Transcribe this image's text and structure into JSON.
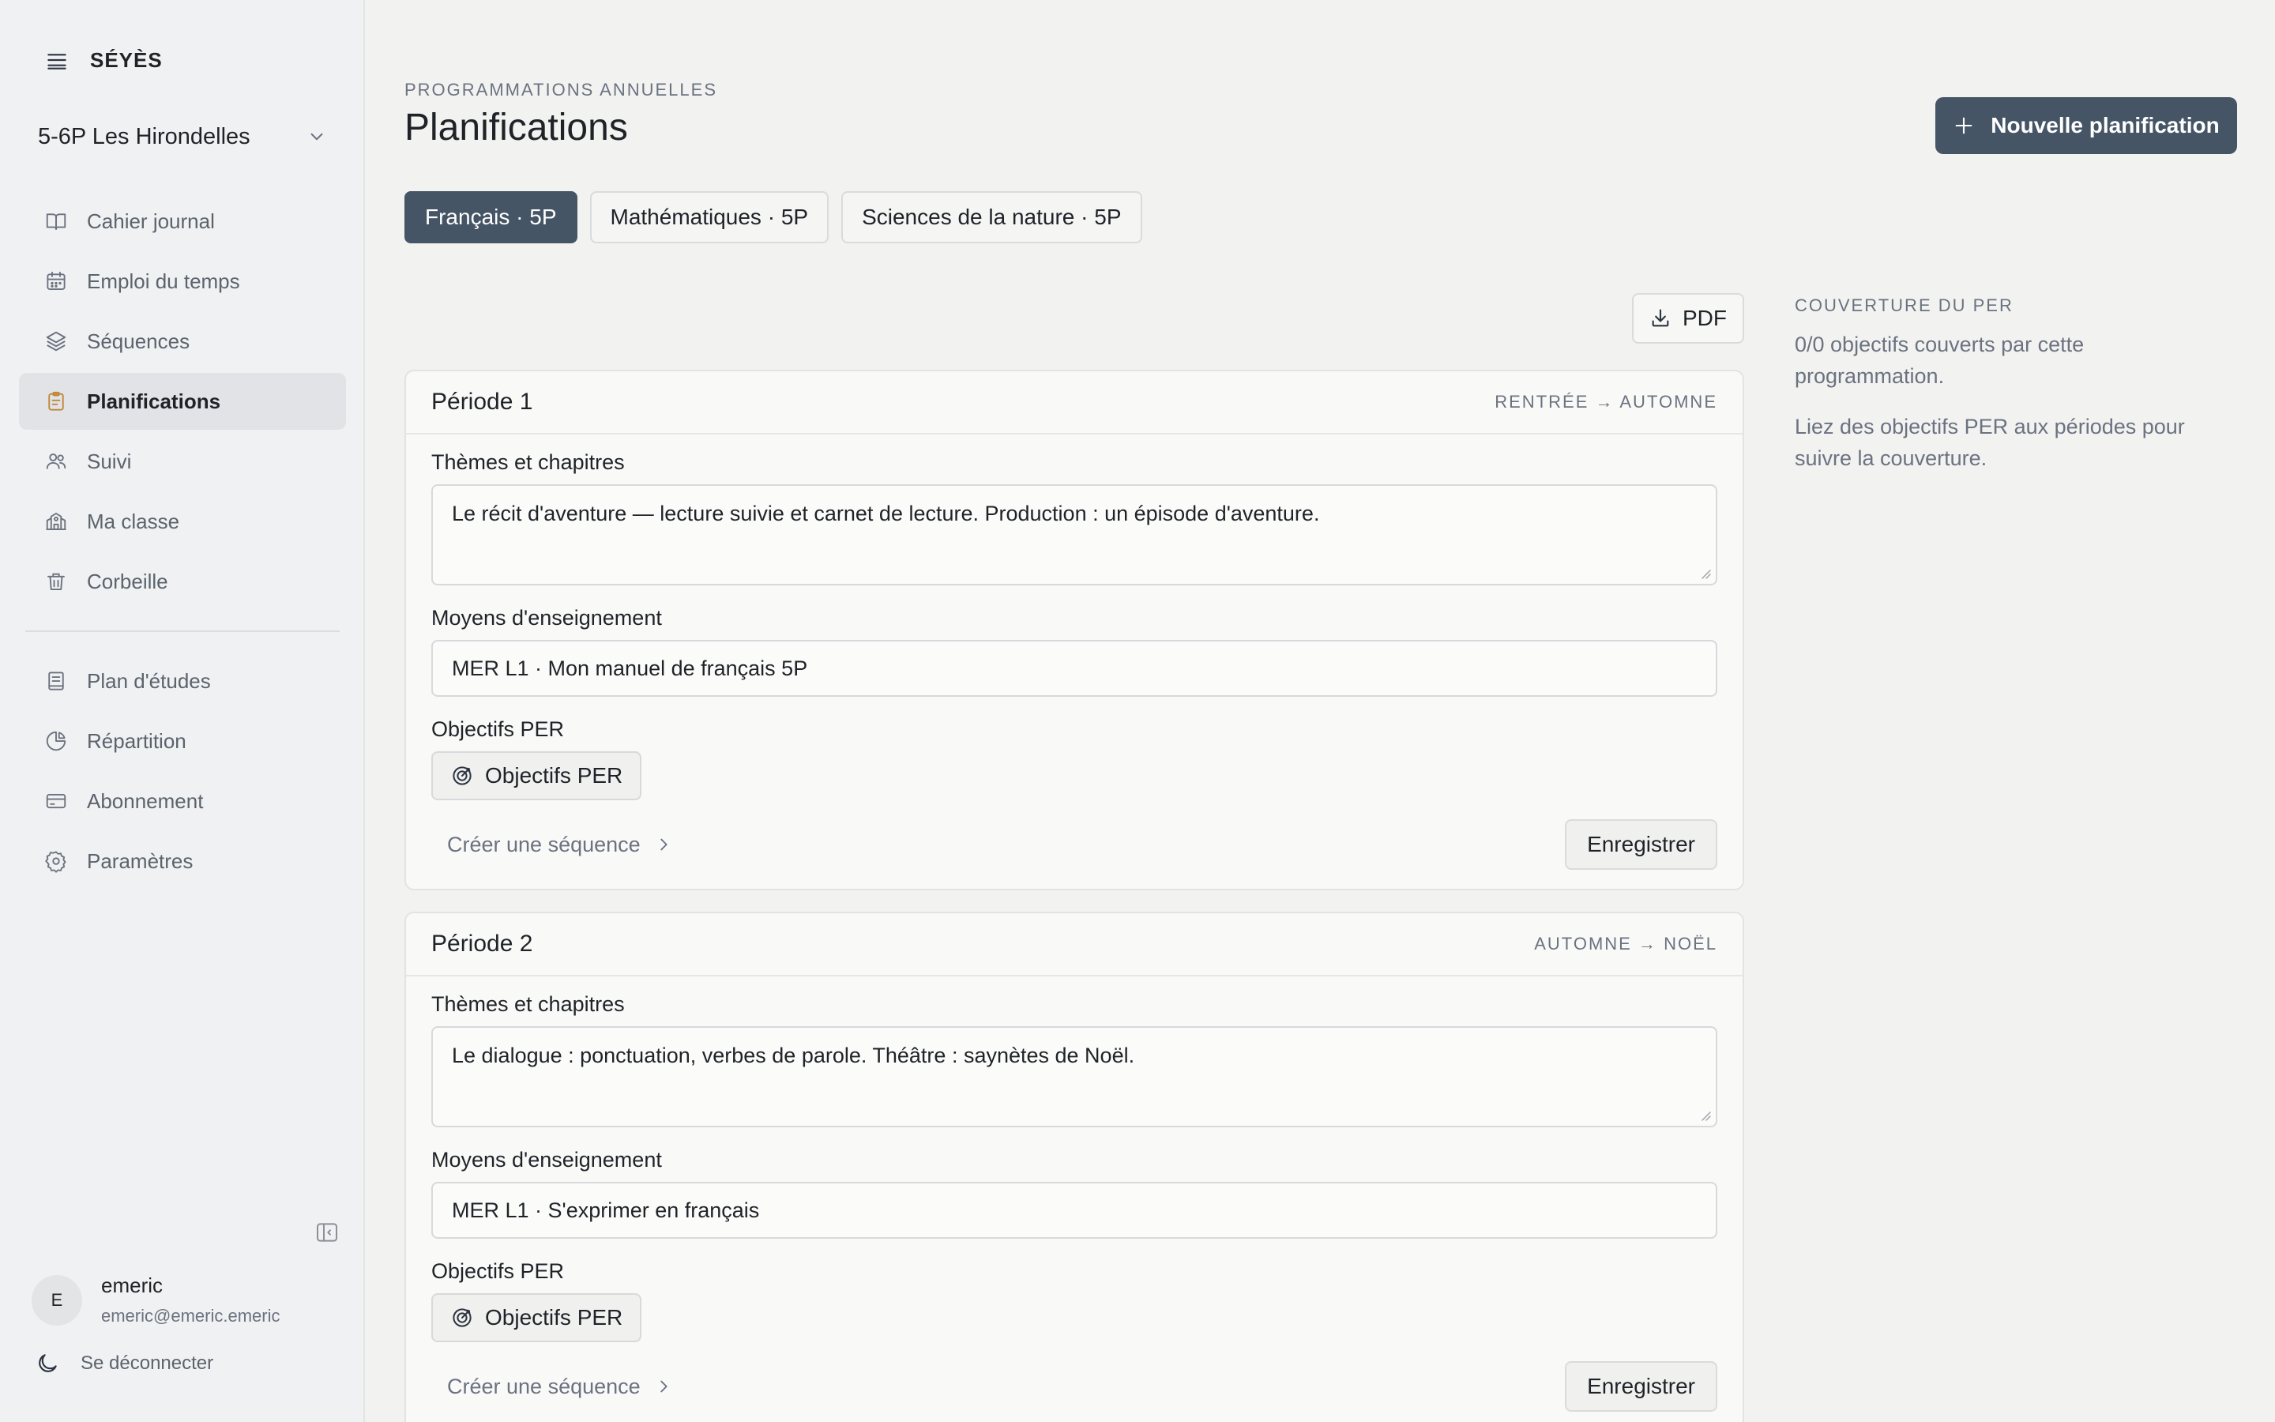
{
  "app": {
    "brand": "SÉYÈS"
  },
  "class_selector": {
    "selected": "5-6P Les Hirondelles"
  },
  "nav": {
    "primary": [
      {
        "label": "Cahier journal",
        "icon": "book-open-icon"
      },
      {
        "label": "Emploi du temps",
        "icon": "calendar-icon"
      },
      {
        "label": "Séquences",
        "icon": "layers-icon"
      },
      {
        "label": "Planifications",
        "icon": "clipboard-icon",
        "active": true
      },
      {
        "label": "Suivi",
        "icon": "users-icon"
      },
      {
        "label": "Ma classe",
        "icon": "school-icon"
      },
      {
        "label": "Corbeille",
        "icon": "trash-icon"
      }
    ],
    "secondary": [
      {
        "label": "Plan d'études",
        "icon": "notebook-icon"
      },
      {
        "label": "Répartition",
        "icon": "pie-chart-icon"
      },
      {
        "label": "Abonnement",
        "icon": "credit-card-icon"
      },
      {
        "label": "Paramètres",
        "icon": "gear-icon"
      }
    ]
  },
  "user": {
    "initial": "E",
    "name": "emeric",
    "email": "emeric@emeric.emeric"
  },
  "logout_label": "Se déconnecter",
  "header": {
    "eyebrow": "PROGRAMMATIONS ANNUELLES",
    "title": "Planifications",
    "new_button": "Nouvelle planification"
  },
  "tabs": [
    {
      "label": "Français · 5P",
      "active": true
    },
    {
      "label": "Mathématiques · 5P",
      "active": false
    },
    {
      "label": "Sciences de la nature · 5P",
      "active": false
    }
  ],
  "pdf_label": "PDF",
  "periods": [
    {
      "title": "Période 1",
      "range": "RENTRÉE → AUTOMNE",
      "themes_label": "Thèmes et chapitres",
      "themes_value": "Le récit d'aventure — lecture suivie et carnet de lecture. Production : un épisode d'aventure.",
      "means_label": "Moyens d'enseignement",
      "means_value": "MER L1 · Mon manuel de français 5P",
      "objectives_label": "Objectifs PER",
      "objectives_button": "Objectifs PER",
      "create_sequence": "Créer une séquence",
      "save": "Enregistrer"
    },
    {
      "title": "Période 2",
      "range": "AUTOMNE → NOËL",
      "themes_label": "Thèmes et chapitres",
      "themes_value": "Le dialogue : ponctuation, verbes de parole. Théâtre : saynètes de Noël.",
      "means_label": "Moyens d'enseignement",
      "means_value": "MER L1 · S'exprimer en français",
      "objectives_label": "Objectifs PER",
      "objectives_button": "Objectifs PER",
      "create_sequence": "Créer une séquence",
      "save": "Enregistrer"
    }
  ],
  "coverage": {
    "title": "COUVERTURE DU PER",
    "summary": "0/0 objectifs couverts par cette programmation.",
    "hint": "Liez des objectifs PER aux périodes pour suivre la couverture."
  },
  "colors": {
    "accent": "#465566",
    "active_icon": "#c0873a",
    "background": "#f2f2f1"
  }
}
